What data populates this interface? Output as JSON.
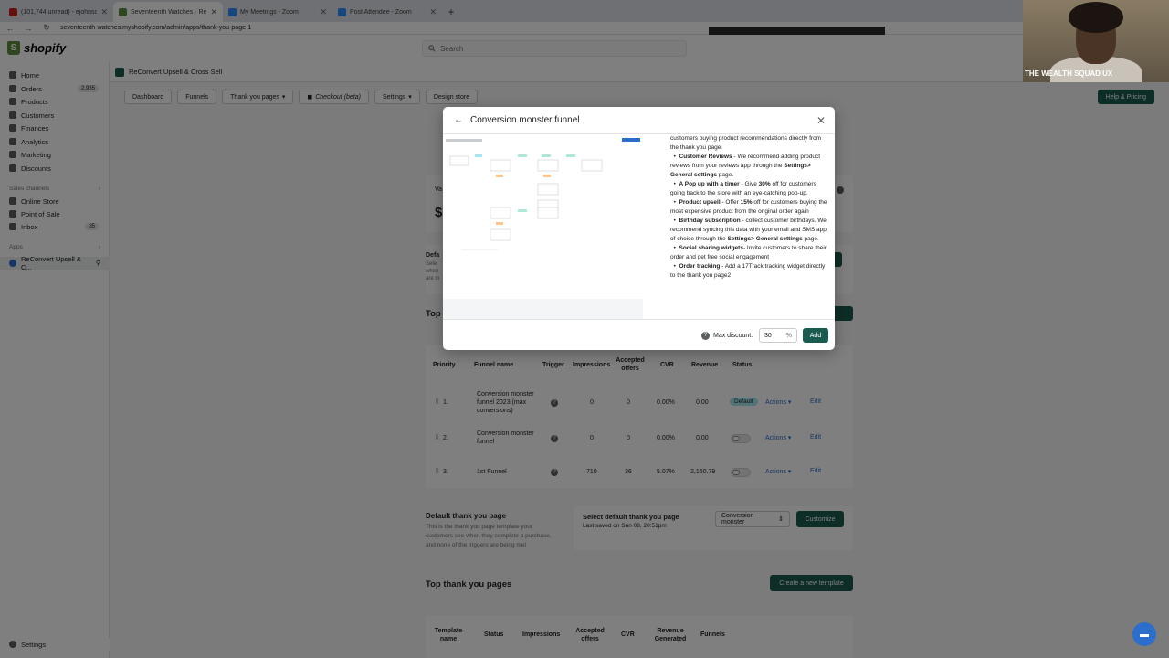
{
  "browser": {
    "tabs": [
      {
        "label": "(101,744 unread) - ejohnson!!!",
        "color": "#c5221f"
      },
      {
        "label": "Seventeenth Watches · ReCo...",
        "color": "#5e8e3e"
      },
      {
        "label": "My Meetings - Zoom",
        "color": "#2d8cff"
      },
      {
        "label": "Post Attendee - Zoom",
        "color": "#2d8cff"
      }
    ],
    "url": "seventeenth-watches.myshopify.com/admin/apps/thank-you-page-1"
  },
  "webcam": {
    "watermark": "THE WEALTH SQUAD UX"
  },
  "shopify": {
    "logo": "shopify",
    "search_placeholder": "Search"
  },
  "sidebar": {
    "items": [
      {
        "label": "Home",
        "badge": ""
      },
      {
        "label": "Orders",
        "badge": "2,935"
      },
      {
        "label": "Products",
        "badge": ""
      },
      {
        "label": "Customers",
        "badge": ""
      },
      {
        "label": "Finances",
        "badge": ""
      },
      {
        "label": "Analytics",
        "badge": ""
      },
      {
        "label": "Marketing",
        "badge": ""
      },
      {
        "label": "Discounts",
        "badge": ""
      }
    ],
    "sales_channels_label": "Sales channels",
    "channels": [
      {
        "label": "Online Store",
        "badge": ""
      },
      {
        "label": "Point of Sale",
        "badge": ""
      },
      {
        "label": "Inbox",
        "badge": "85"
      }
    ],
    "apps_label": "Apps",
    "app_item": "ReConvert Upsell & C...",
    "settings": "Settings"
  },
  "app": {
    "name": "ReConvert Upsell & Cross Sell",
    "toolbar": [
      "Dashboard",
      "Funnels",
      "Thank you pages",
      "Checkout (beta)",
      "Settings",
      "Design store"
    ],
    "help": "Help & Pricing"
  },
  "main": {
    "frag_va": "Va",
    "frag_dollar": "$",
    "frag_def": "Defa",
    "frag_sel": "Sele",
    "frag_when": "when",
    "frag_are": "are m",
    "top_title_frag": "Top",
    "table": {
      "headers": [
        "Priority",
        "Funnel name",
        "Trigger",
        "Impressions",
        "Accepted offers",
        "CVR",
        "Revenue",
        "Status"
      ],
      "rows": [
        {
          "priority": "1.",
          "name": "Conversion monster funnel 2023 (max conversions)",
          "impressions": "0",
          "accepted": "0",
          "cvr": "0.00%",
          "revenue": "0.00",
          "status": "Default"
        },
        {
          "priority": "2.",
          "name": "Conversion monster funnel",
          "impressions": "0",
          "accepted": "0",
          "cvr": "0.00%",
          "revenue": "0.00",
          "status": ""
        },
        {
          "priority": "3.",
          "name": "1st Funnel",
          "impressions": "710",
          "accepted": "36",
          "cvr": "5.07%",
          "revenue": "2,160.79",
          "status": ""
        }
      ],
      "actions_label": "Actions",
      "edit_label": "Edit"
    },
    "default_ty": {
      "title": "Default thank you page",
      "desc": "This is the thank you page template your customers see when they complete a purchase, and none of the triggers are being met",
      "select_title": "Select default thank you page",
      "last_saved": "Last saved on Sun 08, 20:51pm",
      "select_value": "Conversion monster",
      "customize": "Customize"
    },
    "top_ty": {
      "title": "Top thank you pages",
      "create": "Create a new template",
      "headers": [
        "Template name",
        "Status",
        "Impressions",
        "Accepted offers",
        "CVR",
        "Revenue Generated",
        "Funnels"
      ]
    }
  },
  "modal": {
    "title": "Conversion monster funnel",
    "intro": "customers buying product recommendations directly from the thank you page.",
    "bullets": [
      {
        "bold": "Customer Reviews",
        "text": " - We recommend adding product reviews from your reviews app through the ",
        "bold2": "Settings> General settings",
        "text2": " page."
      },
      {
        "bold": "A Pop up with a timer",
        "text": " - Give ",
        "bold2": "30%",
        "text2": " off for customers going back to the store with an eye-catching pop-up."
      },
      {
        "bold": "Product upsell",
        "text": " - Offer ",
        "bold2": "15%",
        "text2": " off for customers buying the most expensive product from the original order again"
      },
      {
        "bold": "Birthday subscription",
        "text": " - collect customer birthdays. We recommend syncing this data with your email and SMS app of choice through the ",
        "bold2": "Settings> General settings",
        "text2": " page."
      },
      {
        "bold": "Social sharing widgets",
        "text": "- Invite customers to share their order and get free social engagement",
        "bold2": "",
        "text2": ""
      },
      {
        "bold": "Order tracking",
        "text": " - Add a 17Track tracking widget directly to the thank you page2",
        "bold2": "",
        "text2": ""
      }
    ],
    "max_discount_label": "Max discount:",
    "max_discount_value": "30",
    "percent": "%",
    "add": "Add"
  }
}
